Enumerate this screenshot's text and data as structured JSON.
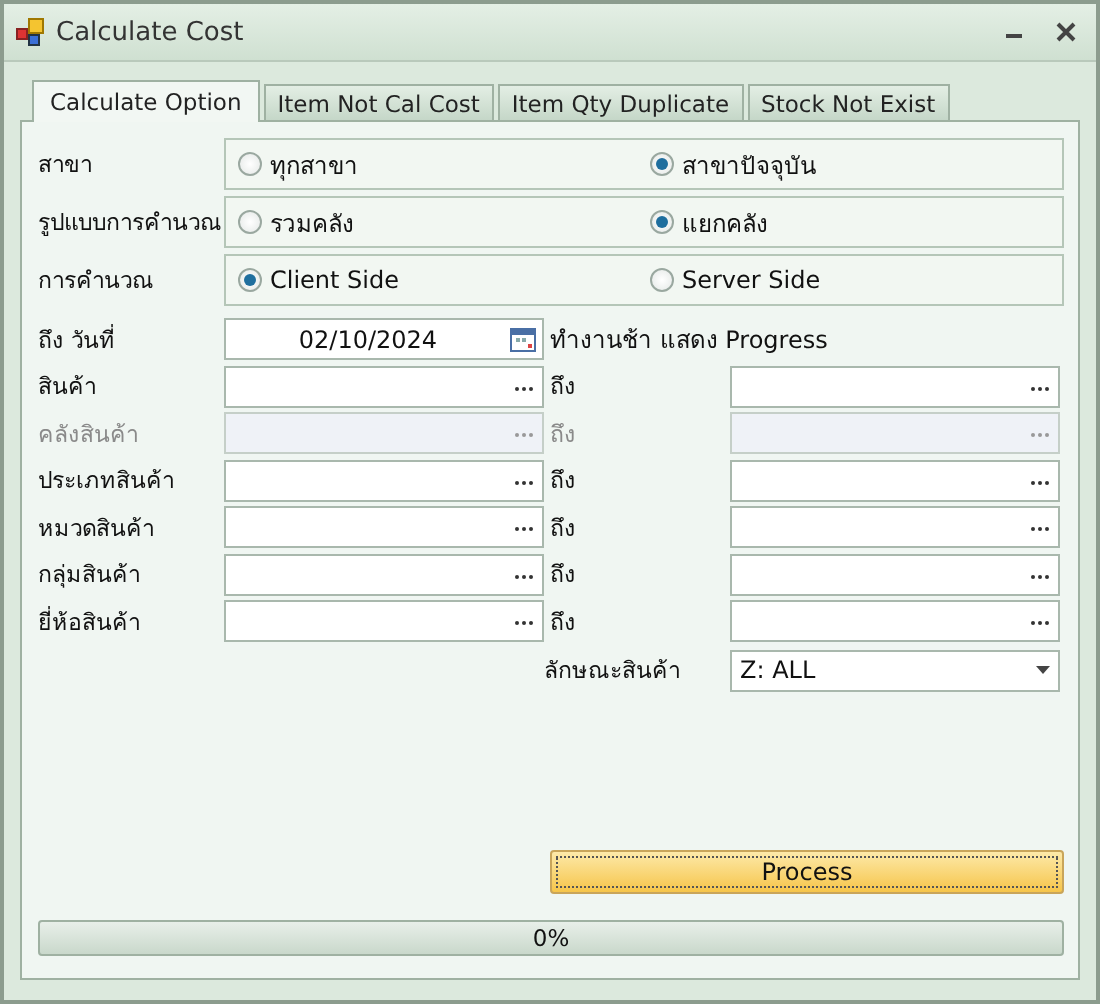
{
  "window": {
    "title": "Calculate Cost"
  },
  "tabs": [
    {
      "label": "Calculate Option",
      "selected": true
    },
    {
      "label": "Item Not Cal Cost",
      "selected": false
    },
    {
      "label": "Item Qty Duplicate",
      "selected": false
    },
    {
      "label": "Stock Not Exist",
      "selected": false
    }
  ],
  "radio_groups": [
    {
      "label": "สาขา",
      "options": [
        {
          "label": "ทุกสาขา",
          "selected": false
        },
        {
          "label": "สาขาปัจจุบัน",
          "selected": true
        }
      ]
    },
    {
      "label": "รูปแบบการคำนวณ",
      "options": [
        {
          "label": "รวมคลัง",
          "selected": false
        },
        {
          "label": "แยกคลัง",
          "selected": true
        }
      ]
    },
    {
      "label": "การคำนวณ",
      "options": [
        {
          "label": "Client Side",
          "selected": true
        },
        {
          "label": "Server Side",
          "selected": false
        }
      ]
    }
  ],
  "date": {
    "label": "ถึง วันที่",
    "value": "02/10/2024",
    "note": "ทำงานช้า แสดง Progress"
  },
  "ranges": [
    {
      "label": "สินค้า",
      "to_label": "ถึง",
      "disabled": false
    },
    {
      "label": "คลังสินค้า",
      "to_label": "ถึง",
      "disabled": true
    },
    {
      "label": "ประเภทสินค้า",
      "to_label": "ถึง",
      "disabled": false
    },
    {
      "label": "หมวดสินค้า",
      "to_label": "ถึง",
      "disabled": false
    },
    {
      "label": "กลุ่มสินค้า",
      "to_label": "ถึง",
      "disabled": false
    },
    {
      "label": "ยี่ห้อสินค้า",
      "to_label": "ถึง",
      "disabled": false
    }
  ],
  "product_kind": {
    "label": "ลักษณะสินค้า",
    "value": "Z: ALL"
  },
  "process_button": {
    "label": "Process"
  },
  "progress": {
    "level": 0,
    "text": "0%"
  }
}
